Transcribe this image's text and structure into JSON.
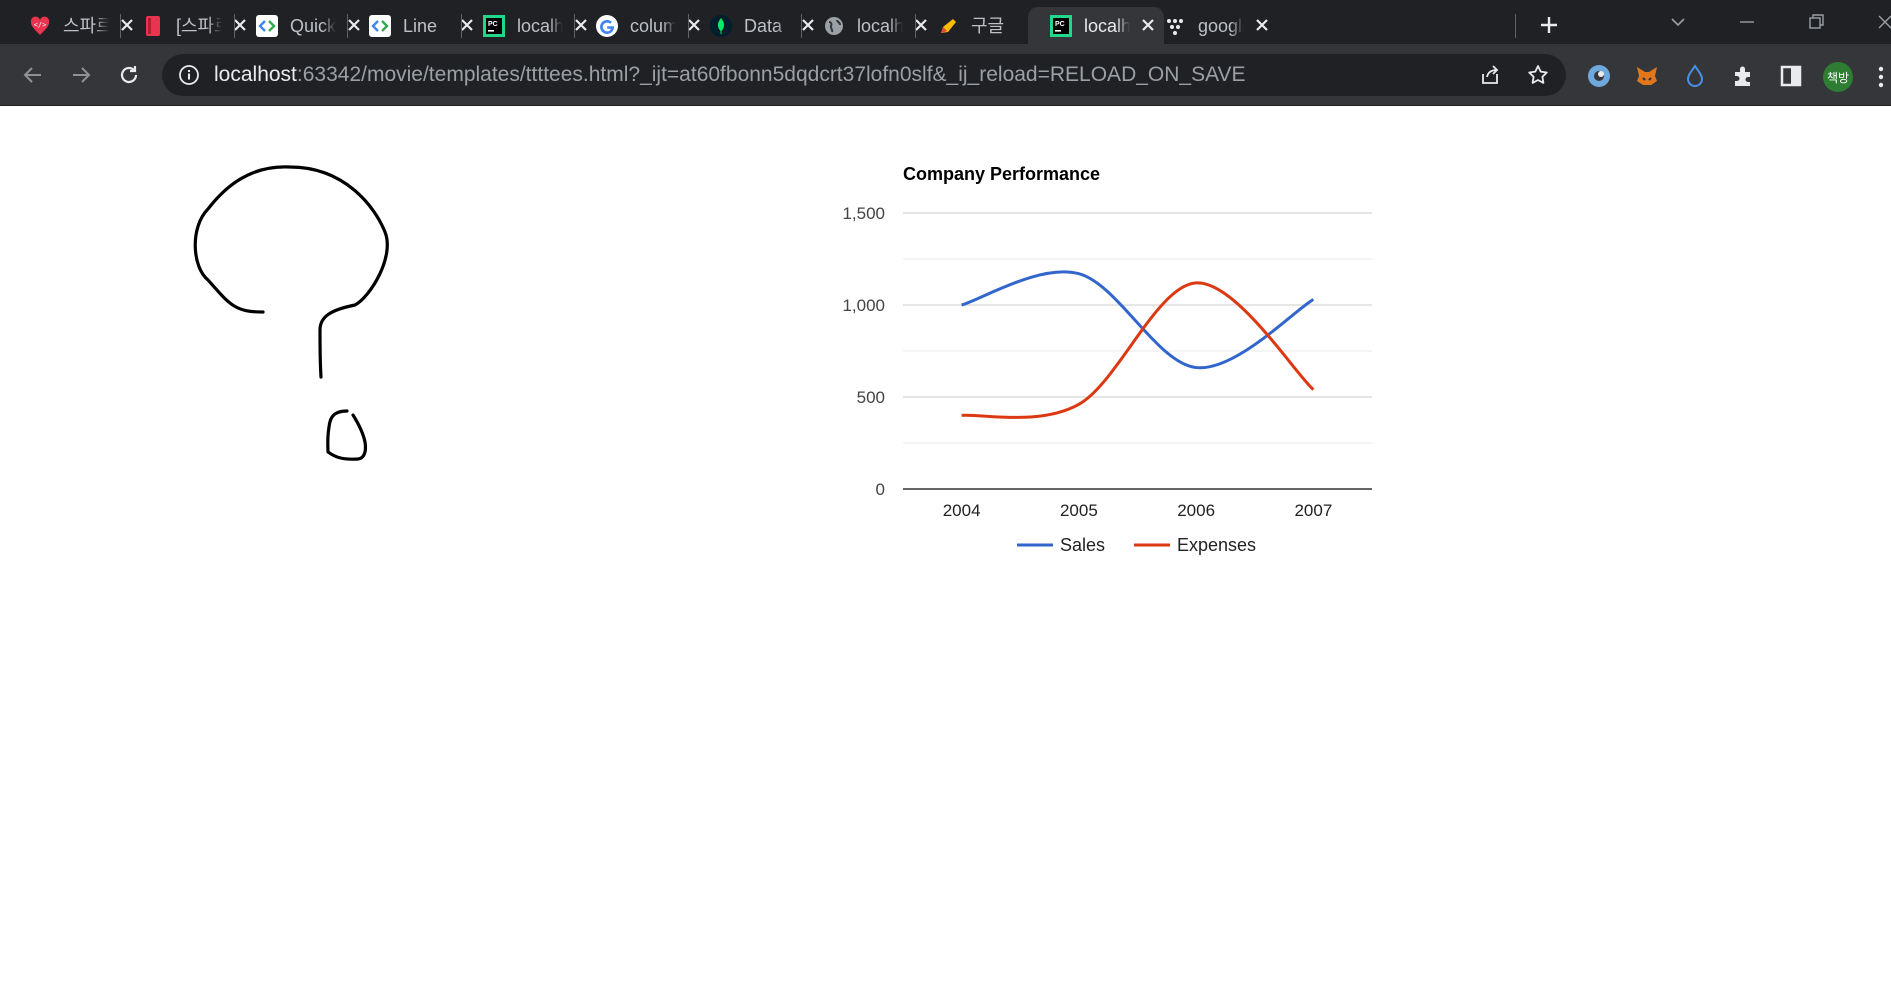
{
  "tabs": [
    {
      "title": "스파르타",
      "favicon": "sparta-code-icon",
      "active": false
    },
    {
      "title": "[스파르타",
      "favicon": "red-bookmark-icon",
      "active": false
    },
    {
      "title": "Quick",
      "favicon": "google-developers-icon",
      "active": false
    },
    {
      "title": "Line",
      "favicon": "google-developers-icon",
      "active": false
    },
    {
      "title": "localhost",
      "favicon": "pycharm-icon",
      "active": false
    },
    {
      "title": "column",
      "favicon": "google-g-icon",
      "active": false
    },
    {
      "title": "Data",
      "favicon": "mongodb-leaf-icon",
      "active": false
    },
    {
      "title": "localhost",
      "favicon": "globe-icon",
      "active": false
    },
    {
      "title": "구글",
      "favicon": "pencil-icon",
      "active": false
    },
    {
      "title": "localhost",
      "favicon": "pycharm-icon",
      "active": true
    },
    {
      "title": "google",
      "favicon": "dots-icon",
      "active": false
    }
  ],
  "toolbar": {
    "url_host": "localhost",
    "url_rest": ":63342/movie/templates/ttttees.html?_ijt=at60fbonn5dqdcrt37lofn0slf&_ij_reload=RELOAD_ON_SAVE",
    "profile_label": "책방"
  },
  "extensions": [
    "edge-swirl-icon",
    "metamask-fox-icon",
    "water-drop-icon",
    "puzzle-extensions-icon",
    "side-panel-icon"
  ],
  "colors": {
    "tab_strip": "#202124",
    "toolbar": "#35363a",
    "sales": "#3366cc",
    "expenses": "#dc3912"
  },
  "chart_data": {
    "type": "line",
    "title": "Company Performance",
    "categories": [
      "2004",
      "2005",
      "2006",
      "2007"
    ],
    "series": [
      {
        "name": "Sales",
        "values": [
          1000,
          1170,
          660,
          1030
        ],
        "color": "#3366cc"
      },
      {
        "name": "Expenses",
        "values": [
          400,
          460,
          1120,
          540
        ],
        "color": "#dc3912"
      }
    ],
    "yticks": [
      "0",
      "500",
      "1,000",
      "1,500"
    ],
    "ylim": [
      0,
      1500
    ],
    "curve": "smooth",
    "grid": true,
    "legend": "bottom"
  }
}
